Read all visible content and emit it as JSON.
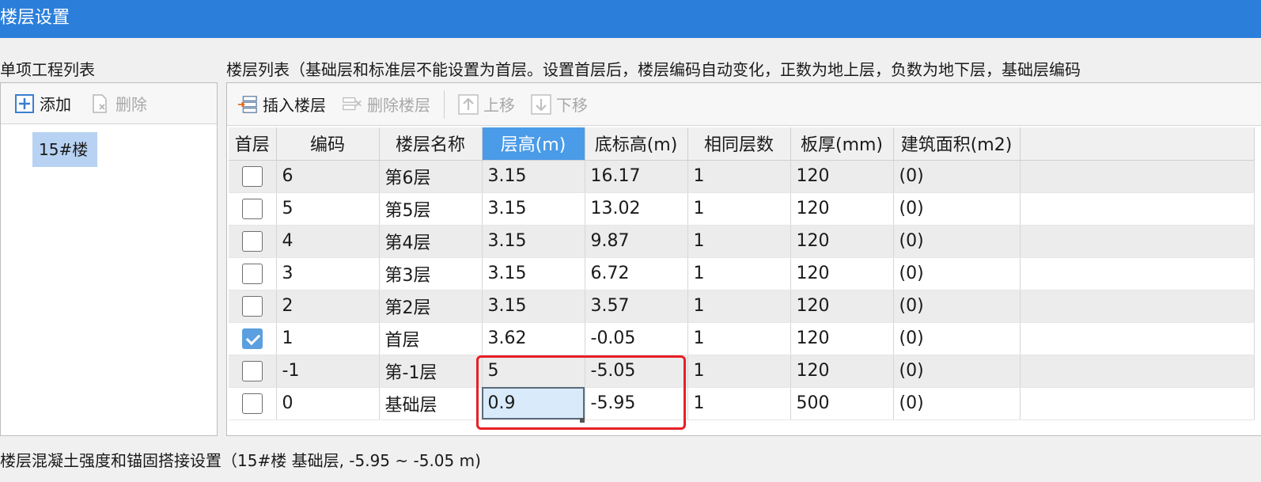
{
  "window": {
    "title": "楼层设置"
  },
  "left": {
    "section_label": "单项工程列表",
    "add_label": "添加",
    "delete_label": "删除",
    "tree_item": "15#楼"
  },
  "right": {
    "section_label": "楼层列表（基础层和标准层不能设置为首层。设置首层后，楼层编码自动变化，正数为地上层，负数为地下层，基础层编码",
    "insert_label": "插入楼层",
    "delete_label": "删除楼层",
    "up_label": "上移",
    "down_label": "下移"
  },
  "table": {
    "headers": [
      "首层",
      "编码",
      "楼层名称",
      "层高(m)",
      "底标高(m)",
      "相同层数",
      "板厚(mm)",
      "建筑面积(m2)"
    ],
    "rows": [
      {
        "first": false,
        "code": "6",
        "name": "第6层",
        "height": "3.15",
        "base": "16.17",
        "count": "1",
        "thick": "120",
        "area": "(0)"
      },
      {
        "first": false,
        "code": "5",
        "name": "第5层",
        "height": "3.15",
        "base": "13.02",
        "count": "1",
        "thick": "120",
        "area": "(0)"
      },
      {
        "first": false,
        "code": "4",
        "name": "第4层",
        "height": "3.15",
        "base": "9.87",
        "count": "1",
        "thick": "120",
        "area": "(0)"
      },
      {
        "first": false,
        "code": "3",
        "name": "第3层",
        "height": "3.15",
        "base": "6.72",
        "count": "1",
        "thick": "120",
        "area": "(0)"
      },
      {
        "first": false,
        "code": "2",
        "name": "第2层",
        "height": "3.15",
        "base": "3.57",
        "count": "1",
        "thick": "120",
        "area": "(0)"
      },
      {
        "first": true,
        "code": "1",
        "name": "首层",
        "height": "3.62",
        "base": "-0.05",
        "count": "1",
        "thick": "120",
        "area": "(0)"
      },
      {
        "first": false,
        "code": "-1",
        "name": "第-1层",
        "height": "5",
        "base": "-5.05",
        "count": "1",
        "thick": "120",
        "area": "(0)"
      },
      {
        "first": false,
        "code": "0",
        "name": "基础层",
        "height": "0.9",
        "base": "-5.95",
        "count": "1",
        "thick": "500",
        "area": "(0)"
      }
    ]
  },
  "bottom": {
    "label": "楼层混凝土强度和锚固搭接设置（15#楼  基础层, -5.95 ~ -5.05 m)"
  },
  "colors": {
    "titlebar": "#2b7fdb",
    "active_header": "#4a9be8",
    "highlight": "#e81f26",
    "selection": "#b7d2f2"
  }
}
